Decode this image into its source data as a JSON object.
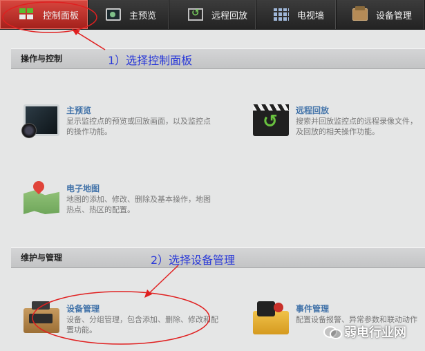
{
  "tabs": [
    {
      "label": "控制面板",
      "icon": "control-panel-grid-icon",
      "active": true
    },
    {
      "label": "主预览",
      "icon": "monitor-icon",
      "active": false
    },
    {
      "label": "远程回放",
      "icon": "replay-icon",
      "active": false
    },
    {
      "label": "电视墙",
      "icon": "tv-wall-icon",
      "active": false
    },
    {
      "label": "设备管理",
      "icon": "device-icon",
      "active": false
    }
  ],
  "sections": [
    {
      "title": "操作与控制"
    },
    {
      "title": "维护与管理"
    }
  ],
  "features": {
    "preview": {
      "title": "主预览",
      "desc": "显示监控点的预览或回放画面，以及监控点的操作功能。",
      "icon": "camera-monitor-icon"
    },
    "replay": {
      "title": "远程回放",
      "desc_line1": "搜索并回放监控点的远程录像文件，",
      "desc_line2": "及回放的相关操作功能。",
      "icon": "clapper-replay-icon"
    },
    "emap": {
      "title": "电子地图",
      "desc": "地图的添加、修改、删除及基本操作，地图热点、热区的配置。",
      "icon": "map-pin-icon"
    },
    "device": {
      "title": "设备管理",
      "desc": "设备、分组管理，包含添加、删除、修改和配置功能。",
      "icon": "device-box-icon"
    },
    "event": {
      "title": "事件管理",
      "desc": "配置设备报警、异常参数和联动动作",
      "icon": "event-folder-icon"
    }
  },
  "annotations": {
    "step1": "1）选择控制面板",
    "step2": "2）选择设备管理"
  },
  "watermark": {
    "text": "弱电行业网"
  },
  "colors": {
    "active_tab": "#c0312b",
    "annotation_red": "#e02020",
    "annotation_blue": "#2a39d8",
    "link_blue": "#4273a9"
  }
}
